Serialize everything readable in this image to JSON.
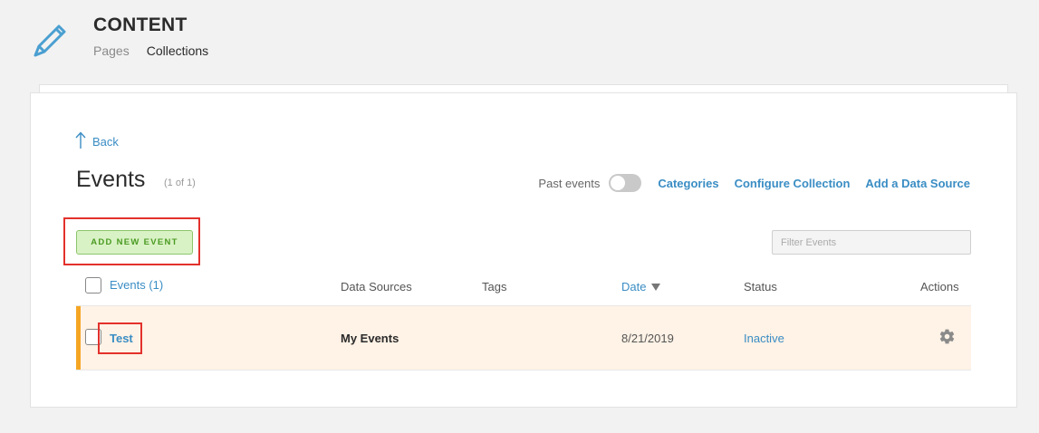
{
  "header": {
    "title": "CONTENT",
    "nav": {
      "pages": "Pages",
      "collections": "Collections"
    }
  },
  "back_label": "Back",
  "collection": {
    "title": "Events",
    "count": "(1 of 1)"
  },
  "toolbar": {
    "past_events_label": "Past events",
    "past_events_on": false,
    "links": [
      "Categories",
      "Configure Collection",
      "Add a Data Source"
    ]
  },
  "add_button": "ADD NEW EVENT",
  "filter": {
    "placeholder": "Filter Events",
    "value": ""
  },
  "table": {
    "headers": {
      "events": "Events (1)",
      "data_sources": "Data Sources",
      "tags": "Tags",
      "date": "Date",
      "status": "Status",
      "actions": "Actions"
    },
    "sort_icon": "sort-down-icon",
    "rows": [
      {
        "title": "Test",
        "data_source": "My Events",
        "tags": "",
        "date": "8/21/2019",
        "status": "Inactive",
        "action_icon": "gear-icon"
      }
    ]
  },
  "colors": {
    "link": "#3a8dc4",
    "row_highlight": "#fff2e6",
    "row_accent": "#f5a623",
    "add_button_bg": "#d9f2c5",
    "annotation": "#e3312c"
  }
}
